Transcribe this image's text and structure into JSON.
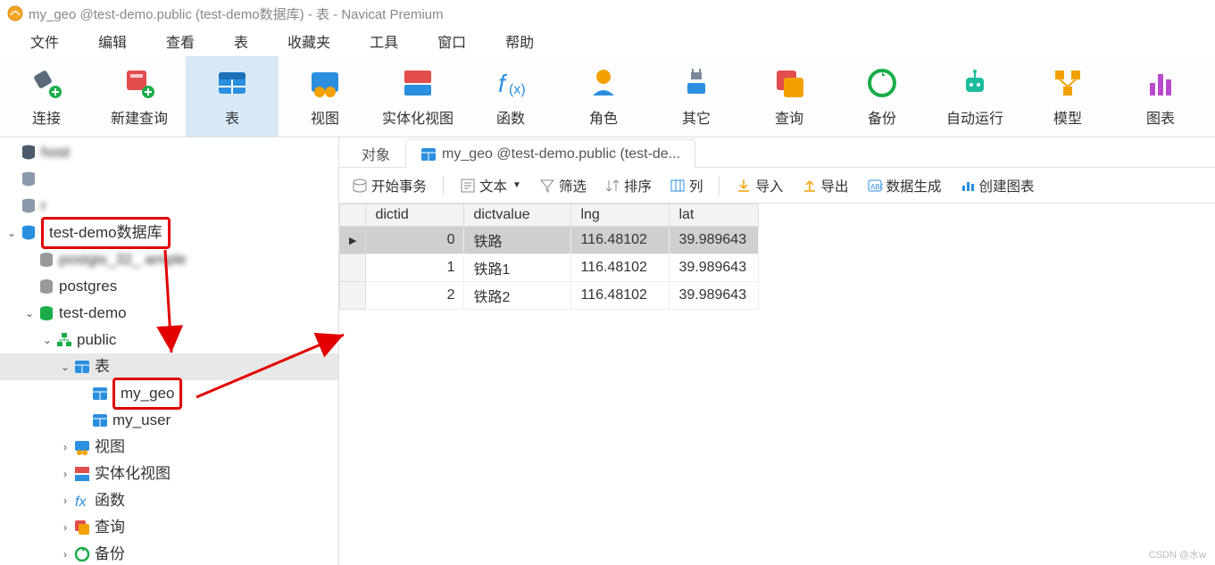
{
  "titlebar": {
    "text": "my_geo @test-demo.public (test-demo数据库) - 表 - Navicat Premium"
  },
  "menu": [
    "文件",
    "编辑",
    "查看",
    "表",
    "收藏夹",
    "工具",
    "窗口",
    "帮助"
  ],
  "toolbar": [
    {
      "name": "connect",
      "label": "连接"
    },
    {
      "name": "newquery",
      "label": "新建查询"
    },
    {
      "name": "table",
      "label": "表",
      "selected": true
    },
    {
      "name": "view",
      "label": "视图"
    },
    {
      "name": "matview",
      "label": "实体化视图"
    },
    {
      "name": "function",
      "label": "函数"
    },
    {
      "name": "role",
      "label": "角色"
    },
    {
      "name": "other",
      "label": "其它"
    },
    {
      "name": "query",
      "label": "查询"
    },
    {
      "name": "backup",
      "label": "备份"
    },
    {
      "name": "autorun",
      "label": "自动运行"
    },
    {
      "name": "model",
      "label": "模型"
    },
    {
      "name": "chart",
      "label": "图表"
    }
  ],
  "tree": {
    "nodes": [
      {
        "d": 0,
        "t": "",
        "icon": "pg",
        "label": "host",
        "blur": true,
        "highlight": false
      },
      {
        "d": 0,
        "t": "",
        "icon": "pg-gray",
        "label": "",
        "blur": true
      },
      {
        "d": 0,
        "t": "",
        "icon": "pg-gray",
        "label": "r ",
        "blur": true
      },
      {
        "d": 0,
        "t": "open",
        "icon": "pg-blue",
        "label": "test-demo数据库",
        "highlight": true
      },
      {
        "d": 1,
        "t": "",
        "icon": "db-gray",
        "label": "postgis_32_  ample",
        "blur": true
      },
      {
        "d": 1,
        "t": "",
        "icon": "db-gray",
        "label": "postgres"
      },
      {
        "d": 1,
        "t": "open",
        "icon": "db-green",
        "label": "test-demo"
      },
      {
        "d": 2,
        "t": "open",
        "icon": "schema",
        "label": "public"
      },
      {
        "d": 3,
        "t": "open",
        "icon": "table-gr",
        "label": "表",
        "selected": true
      },
      {
        "d": 4,
        "t": "",
        "icon": "table",
        "label": "my_geo",
        "highlight": true
      },
      {
        "d": 4,
        "t": "",
        "icon": "table",
        "label": "my_user"
      },
      {
        "d": 3,
        "t": "closed",
        "icon": "view",
        "label": "视图"
      },
      {
        "d": 3,
        "t": "closed",
        "icon": "matview",
        "label": "实体化视图"
      },
      {
        "d": 3,
        "t": "closed",
        "icon": "func",
        "label": "函数"
      },
      {
        "d": 3,
        "t": "closed",
        "icon": "query",
        "label": "查询"
      },
      {
        "d": 3,
        "t": "closed",
        "icon": "backup",
        "label": "备份"
      }
    ]
  },
  "tabs": {
    "t0": "对象",
    "t1": "my_geo @test-demo.public (test-de..."
  },
  "subtool": {
    "begin": "开始事务",
    "text": "文本",
    "filter": "筛选",
    "sort": "排序",
    "columns": "列",
    "import": "导入",
    "export": "导出",
    "datagen": "数据生成",
    "createchart": "创建图表"
  },
  "table": {
    "headers": [
      "dictid",
      "dictvalue",
      "lng",
      "lat"
    ],
    "rows": [
      {
        "dictid": "0",
        "dictvalue": "铁路",
        "lng": "116.48102",
        "lat": "39.989643",
        "sel": true
      },
      {
        "dictid": "1",
        "dictvalue": "铁路1",
        "lng": "116.48102",
        "lat": "39.989643"
      },
      {
        "dictid": "2",
        "dictvalue": "铁路2",
        "lng": "116.48102",
        "lat": "39.989643"
      }
    ]
  },
  "watermark": "CSDN @水w"
}
